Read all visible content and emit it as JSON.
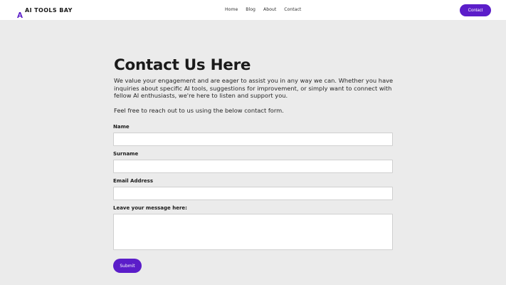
{
  "header": {
    "logo_text": "AI TOOLS BAY",
    "nav": [
      "Home",
      "Blog",
      "About",
      "Contact"
    ],
    "cta_label": "Contact"
  },
  "main": {
    "title": "Contact Us Here",
    "intro": "We value your engagement and are eager to assist you in any way we can. Whether you have inquiries about specific AI tools, suggestions for improvement, or simply want to connect with fellow AI enthusiasts, we're here to listen and support you.",
    "intro2": "Feel free to reach out to us using the below contact form."
  },
  "form": {
    "name_label": "Name",
    "name_value": "",
    "surname_label": "Surname",
    "surname_value": "",
    "email_label": "Email Address",
    "email_value": "",
    "message_label": "Leave your message here:",
    "message_value": "",
    "submit_label": "Submit"
  },
  "colors": {
    "accent": "#5b1dc9",
    "background": "#ebebeb"
  }
}
